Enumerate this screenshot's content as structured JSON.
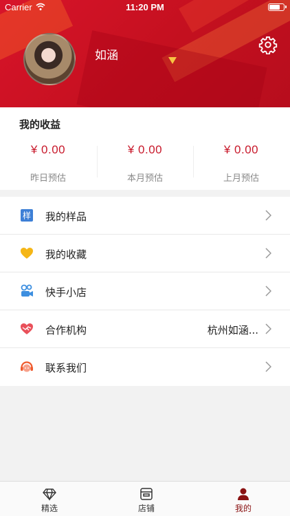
{
  "status_bar": {
    "carrier": "Carrier",
    "time": "11:20 PM",
    "battery_level": 0.7
  },
  "profile": {
    "name": "如涵"
  },
  "earnings": {
    "title": "我的收益",
    "items": [
      {
        "amount": "¥ 0.00",
        "label": "昨日预估"
      },
      {
        "amount": "¥ 0.00",
        "label": "本月预估"
      },
      {
        "amount": "¥ 0.00",
        "label": "上月预估"
      }
    ]
  },
  "menu": {
    "items": [
      {
        "label": "我的样品",
        "icon": "sample-icon",
        "icon_text": "样",
        "value": ""
      },
      {
        "label": "我的收藏",
        "icon": "heart-icon",
        "value": ""
      },
      {
        "label": "快手小店",
        "icon": "shop-icon",
        "value": ""
      },
      {
        "label": "合作机构",
        "icon": "handshake-icon",
        "value": "杭州如涵..."
      },
      {
        "label": "联系我们",
        "icon": "headset-icon",
        "value": ""
      }
    ]
  },
  "tabbar": {
    "tabs": [
      {
        "label": "精选",
        "icon": "diamond-icon",
        "active": false
      },
      {
        "label": "店铺",
        "icon": "store-icon",
        "active": false
      },
      {
        "label": "我的",
        "icon": "user-icon",
        "active": true
      }
    ]
  },
  "colors": {
    "accent": "#c8192b",
    "header": "#d8142a",
    "active_tab": "#8a1212"
  }
}
